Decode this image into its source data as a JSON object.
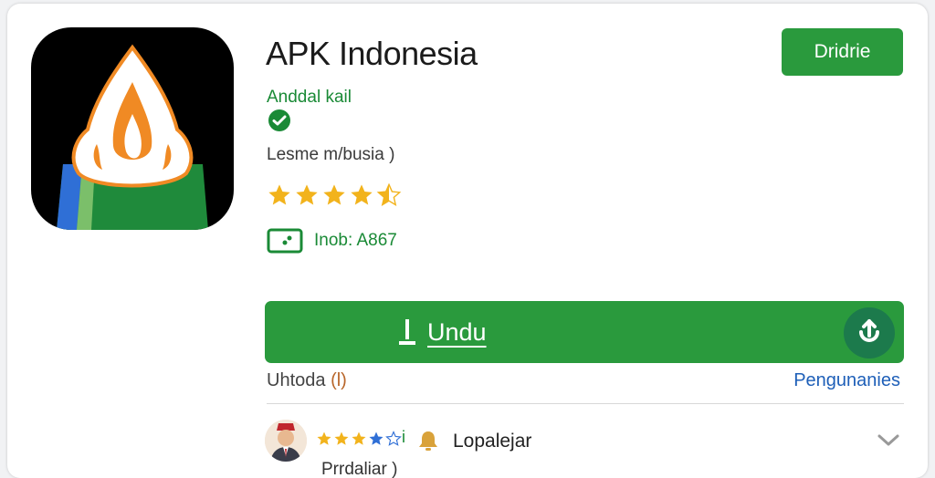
{
  "app": {
    "title": "APK Indonesia",
    "developer": "Anddal kail",
    "category": "Lesme m/busia )",
    "rating_stars": 4.5,
    "age_label": "Inob: A867"
  },
  "header": {
    "top_button_label": "Dridrie"
  },
  "actions": {
    "download_label": "Undu",
    "updated_label": "Uhtoda",
    "updated_count": "(l)",
    "privacy_link": "Pengunanies"
  },
  "review": {
    "reviewer_name": "Lopalejar",
    "sub_text": "Prrdaliar )",
    "separator": "i"
  },
  "colors": {
    "brand_green": "#2a9a3d",
    "dev_green": "#1a8a36",
    "link_blue": "#1e5fb8",
    "star_gold": "#f2b31c"
  },
  "icons": {
    "app_icon": "flame-app-icon",
    "verified": "check-circle-icon",
    "age": "rating-badge-icon",
    "download": "download-arrow-icon",
    "share": "share-icon",
    "bell": "bell-icon",
    "expand": "chevron-down-icon"
  }
}
